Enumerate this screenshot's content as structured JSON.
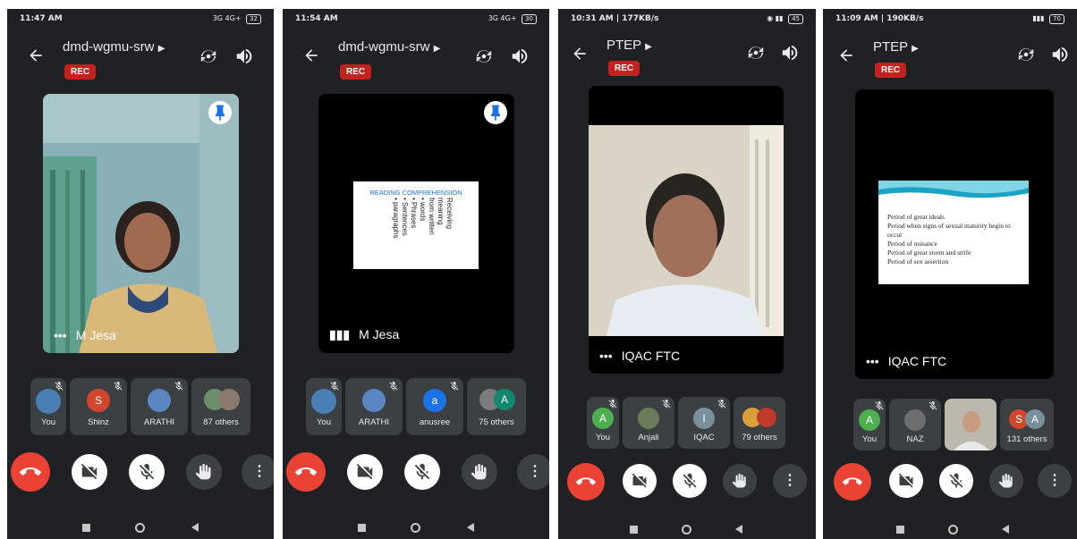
{
  "colors": {
    "phone_bg": "#202124",
    "tile_bg": "#000000",
    "rec": "#c5221f",
    "end_call": "#ea4335",
    "chip": "#3c4043",
    "accent_blue": "#1a73e8"
  },
  "phones": [
    {
      "status_time": "11:47 AM",
      "status_icons": "3G 4G+",
      "battery": "32",
      "meeting_title": "dmd-wgmu-srw",
      "rec_label": "REC",
      "main_tile_name": "M Jesa",
      "participants": [
        {
          "avatar_letter": "",
          "label": "You"
        },
        {
          "avatar_letter": "S",
          "label": "Shinz"
        },
        {
          "avatar_letter": "",
          "label": "ARATHI"
        },
        {
          "avatar_letter": "",
          "label": "87 others"
        }
      ]
    },
    {
      "status_time": "11:54 AM",
      "status_icons": "3G 4G+",
      "battery": "30",
      "meeting_title": "dmd-wgmu-srw",
      "rec_label": "REC",
      "main_tile_name": "M Jesa",
      "slide_title": "READING COMPREHENSION",
      "slide_lines": [
        "Receiving",
        "meaning",
        "from written",
        "• words",
        "• Phrases",
        "• Sentences",
        "• paragraphs"
      ],
      "participants": [
        {
          "avatar_letter": "",
          "label": "You"
        },
        {
          "avatar_letter": "",
          "label": "ARATHI"
        },
        {
          "avatar_letter": "a",
          "label": "anusree"
        },
        {
          "avatar_letter": "A",
          "label": "75 others"
        }
      ]
    },
    {
      "status_time": "10:31 AM | 177KB/s",
      "status_icons": "",
      "battery": "45",
      "meeting_title": "PTEP",
      "rec_label": "REC",
      "main_tile_name": "IQAC FTC",
      "participants": [
        {
          "avatar_letter": "A",
          "label": "You"
        },
        {
          "avatar_letter": "",
          "label": "Anjali"
        },
        {
          "avatar_letter": "I",
          "label": "IQAC"
        },
        {
          "avatar_letter": "",
          "label": "79 others"
        }
      ]
    },
    {
      "status_time": "11:09 AM | 190KB/s",
      "status_icons": "",
      "battery": "70",
      "meeting_title": "PTEP",
      "rec_label": "REC",
      "main_tile_name": "IQAC FTC",
      "slide_lines": [
        "Period of great ideals",
        "Period when signs of sexual maturity begin to occur",
        "Period of nuisance",
        "Period of great storm and strife",
        "Period of sex assertion"
      ],
      "participants": [
        {
          "avatar_letter": "A",
          "label": "You"
        },
        {
          "avatar_letter": "",
          "label": "NAZ"
        },
        {
          "avatar_letter": "",
          "label": ""
        },
        {
          "avatar_letter": "S",
          "label": "131 others"
        }
      ],
      "p4_avatar_second": "A"
    }
  ]
}
